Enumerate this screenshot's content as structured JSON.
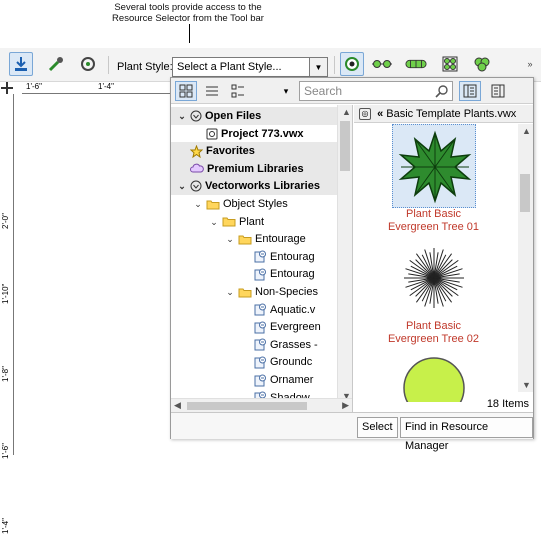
{
  "callout": {
    "line1": "Several tools provide access to the",
    "line2": "Resource Selector from the Tool bar"
  },
  "toolbar": {
    "plant_style_label": "Plant Style:",
    "plant_style_value": "Select a Plant Style...",
    "icons": [
      "plant-tool-icon",
      "eyedropper-icon",
      "plant-options-icon",
      "radio-mode-icon",
      "line-mode-icon",
      "spacing-mode-icon",
      "grid-mode-icon",
      "cluster-mode-icon"
    ]
  },
  "rulers": {
    "top": [
      "1'-6\"",
      "1'-4\""
    ],
    "left": [
      "2'-0\"",
      "1'-10\"",
      "1'-8\"",
      "1'-6\"",
      "1'-4\""
    ]
  },
  "panel": {
    "search_placeholder": "Search",
    "tree": [
      {
        "label": "Open Files",
        "bold": true,
        "shaded": true,
        "level": 0,
        "chev": "v",
        "icon": "file-circle"
      },
      {
        "label": "Project 773.vwx",
        "bold": true,
        "shaded": false,
        "level": 1,
        "chev": "",
        "icon": "file-vw"
      },
      {
        "label": "Favorites",
        "bold": true,
        "shaded": true,
        "level": 0,
        "chev": "",
        "icon": "star"
      },
      {
        "label": "Premium Libraries",
        "bold": true,
        "shaded": true,
        "level": 0,
        "chev": "",
        "icon": "cloud"
      },
      {
        "label": "Vectorworks Libraries",
        "bold": true,
        "shaded": true,
        "level": 0,
        "chev": "v",
        "icon": "file-circle"
      },
      {
        "label": "Object Styles",
        "bold": false,
        "shaded": false,
        "level": 1,
        "chev": "v",
        "icon": "folder"
      },
      {
        "label": "Plant",
        "bold": false,
        "shaded": false,
        "level": 2,
        "chev": "v",
        "icon": "folder"
      },
      {
        "label": "Entourage",
        "bold": false,
        "shaded": false,
        "level": 3,
        "chev": "v",
        "icon": "folder"
      },
      {
        "label": "Entourag",
        "bold": false,
        "shaded": false,
        "level": 4,
        "chev": "",
        "icon": "vwfile"
      },
      {
        "label": "Entourag",
        "bold": false,
        "shaded": false,
        "level": 4,
        "chev": "",
        "icon": "vwfile"
      },
      {
        "label": "Non-Species",
        "bold": false,
        "shaded": false,
        "level": 3,
        "chev": "v",
        "icon": "folder"
      },
      {
        "label": "Aquatic.v",
        "bold": false,
        "shaded": false,
        "level": 4,
        "chev": "",
        "icon": "vwfile"
      },
      {
        "label": "Evergreen",
        "bold": false,
        "shaded": false,
        "level": 4,
        "chev": "",
        "icon": "vwfile"
      },
      {
        "label": "Grasses -",
        "bold": false,
        "shaded": false,
        "level": 4,
        "chev": "",
        "icon": "vwfile"
      },
      {
        "label": "Groundc",
        "bold": false,
        "shaded": false,
        "level": 4,
        "chev": "",
        "icon": "vwfile"
      },
      {
        "label": "Ornamer",
        "bold": false,
        "shaded": false,
        "level": 4,
        "chev": "",
        "icon": "vwfile"
      },
      {
        "label": "Shadow",
        "bold": false,
        "shaded": false,
        "level": 4,
        "chev": "",
        "icon": "vwfile"
      }
    ],
    "file_header": "Basic Template Plants.vwx",
    "items": [
      {
        "line1": "Plant Basic",
        "line2": "Evergreen Tree 01",
        "selected": true
      },
      {
        "line1": "Plant Basic",
        "line2": "Evergreen Tree 02",
        "selected": false
      },
      {
        "line1": "",
        "line2": "",
        "selected": false
      }
    ],
    "item_count": "18 Items",
    "select_label": "Select",
    "find_label": "Find in Resource Manager"
  }
}
